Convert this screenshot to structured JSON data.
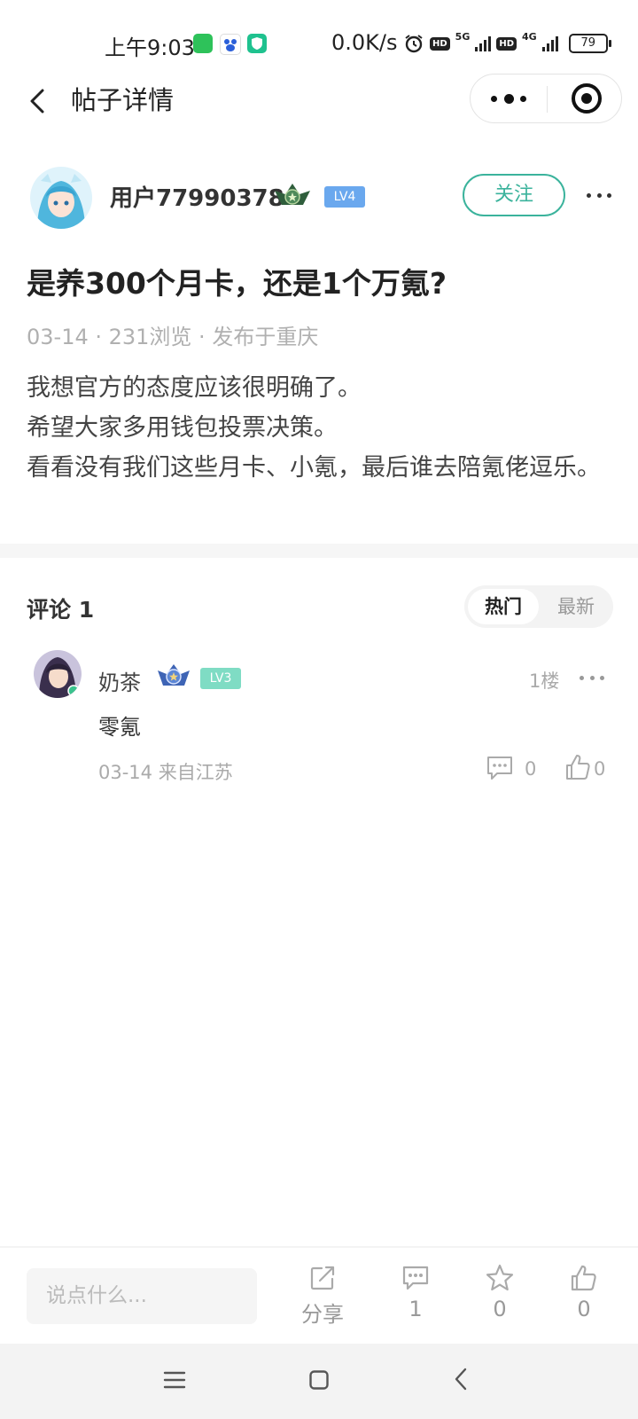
{
  "status_bar": {
    "time": "上午9:03",
    "net_speed": "0.0K/s",
    "net1": "5G",
    "net2": "4G",
    "hd": "HD",
    "battery": "79"
  },
  "nav": {
    "title": "帖子详情"
  },
  "post": {
    "author": "用户77990378",
    "level": "LV4",
    "follow_label": "关注",
    "title": "是养300个月卡，还是1个万氪?",
    "meta": "03-14 · 231浏览 · 发布于重庆",
    "body_lines": [
      "我想官方的态度应该很明确了。",
      "希望大家多用钱包投票决策。",
      "看看没有我们这些月卡、小氪，最后谁去陪氪佬逗乐。"
    ]
  },
  "comments_section": {
    "header": "评论 1",
    "sort_hot": "热门",
    "sort_new": "最新",
    "items": [
      {
        "name": "奶茶",
        "level": "LV3",
        "floor": "1楼",
        "text": "零氪",
        "meta": "03-14  来自江苏",
        "reply_count": "0",
        "like_count": "0"
      }
    ]
  },
  "bottom_bar": {
    "input_placeholder": "说点什么...",
    "share_label": "分享",
    "comment_count": "1",
    "favorite_count": "0",
    "like_count": "0"
  },
  "colors": {
    "accent": "#3bb39c",
    "lv4": "#6aa8ee",
    "lv3": "#7fdcc4"
  }
}
